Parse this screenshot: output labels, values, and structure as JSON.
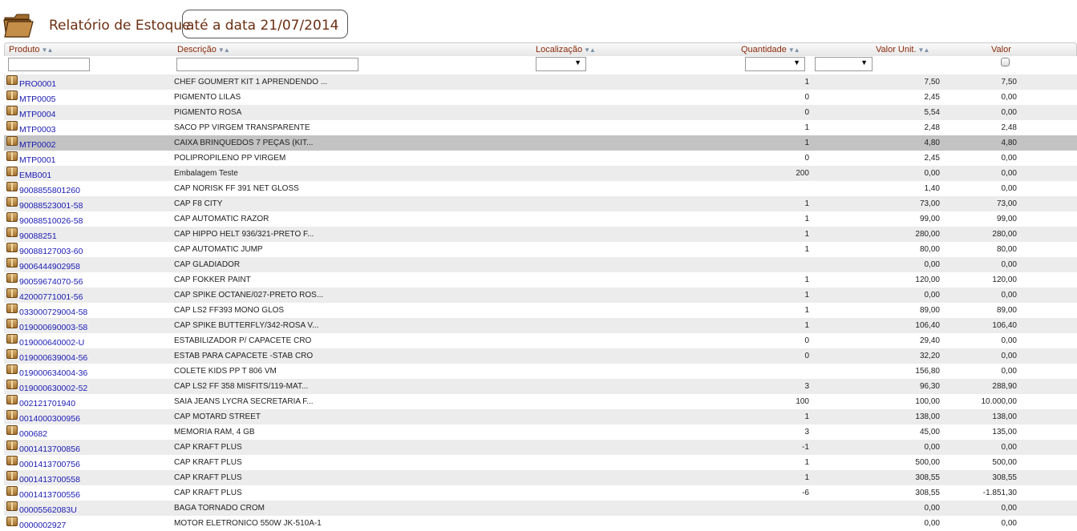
{
  "header": {
    "title": "Relatório de Estoque",
    "date_label": "até a data 21/07/2014"
  },
  "columns": {
    "produto": "Produto",
    "descricao": "Descrição",
    "localizacao": "Localização",
    "quantidade": "Quantidade",
    "valor_unit": "Valor Unit.",
    "valor": "Valor"
  },
  "icons": {
    "title": "folder-icon",
    "row": "package-icon",
    "sort": "sort-arrows-icon",
    "dropdown": "dropdown-arrow-icon"
  },
  "filters": {
    "produto_value": "",
    "descricao_value": "",
    "localizacao_selected": "",
    "quantidade_op_selected": "",
    "quantidade_selected": "",
    "valor_checked": false
  },
  "selected_row": 4,
  "rows": [
    {
      "code": "PRO0001",
      "desc": "CHEF GOUMERT KIT 1 APRENDENDO ...",
      "qty": "1",
      "unit": "7,50",
      "value": "7,50"
    },
    {
      "code": "MTP0005",
      "desc": "PIGMENTO LILAS",
      "qty": "0",
      "unit": "2,45",
      "value": "0,00"
    },
    {
      "code": "MTP0004",
      "desc": "PIGMENTO ROSA",
      "qty": "0",
      "unit": "5,54",
      "value": "0,00"
    },
    {
      "code": "MTP0003",
      "desc": "SACO PP VIRGEM TRANSPARENTE",
      "qty": "1",
      "unit": "2,48",
      "value": "2,48"
    },
    {
      "code": "MTP0002",
      "desc": "CAIXA BRINQUEDOS 7 PEÇAS (KIT...",
      "qty": "1",
      "unit": "4,80",
      "value": "4,80"
    },
    {
      "code": "MTP0001",
      "desc": "POLIPROPILENO PP VIRGEM",
      "qty": "0",
      "unit": "2,45",
      "value": "0,00"
    },
    {
      "code": "EMB001",
      "desc": "Embalagem Teste",
      "qty": "200",
      "unit": "0,00",
      "value": "0,00"
    },
    {
      "code": "9008855801260",
      "desc": "CAP NORISK FF 391 NET GLOSS",
      "qty": "",
      "unit": "1,40",
      "value": "0,00"
    },
    {
      "code": "90088523001-58",
      "desc": "CAP F8 CITY",
      "qty": "1",
      "unit": "73,00",
      "value": "73,00"
    },
    {
      "code": "90088510026-58",
      "desc": "CAP AUTOMATIC RAZOR",
      "qty": "1",
      "unit": "99,00",
      "value": "99,00"
    },
    {
      "code": "90088251",
      "desc": "CAP HIPPO HELT 936/321-PRETO F...",
      "qty": "1",
      "unit": "280,00",
      "value": "280,00"
    },
    {
      "code": "90088127003-60",
      "desc": "CAP AUTOMATIC JUMP",
      "qty": "1",
      "unit": "80,00",
      "value": "80,00"
    },
    {
      "code": "9006444902958",
      "desc": "CAP GLADIADOR",
      "qty": "",
      "unit": "0,00",
      "value": "0,00"
    },
    {
      "code": "90059674070-56",
      "desc": "CAP FOKKER PAINT",
      "qty": "1",
      "unit": "120,00",
      "value": "120,00"
    },
    {
      "code": "42000771001-56",
      "desc": "CAP SPIKE OCTANE/027-PRETO ROS...",
      "qty": "1",
      "unit": "0,00",
      "value": "0,00"
    },
    {
      "code": "033000729004-58",
      "desc": "CAP LS2 FF393 MONO GLOS",
      "qty": "1",
      "unit": "89,00",
      "value": "89,00"
    },
    {
      "code": "019000690003-58",
      "desc": "CAP SPIKE BUTTERFLY/342-ROSA V...",
      "qty": "1",
      "unit": "106,40",
      "value": "106,40"
    },
    {
      "code": "019000640002-U",
      "desc": "ESTABILIZADOR P/ CAPACETE CRO",
      "qty": "0",
      "unit": "29,40",
      "value": "0,00"
    },
    {
      "code": "019000639004-56",
      "desc": "ESTAB PARA CAPACETE -STAB CRO",
      "qty": "0",
      "unit": "32,20",
      "value": "0,00"
    },
    {
      "code": "019000634004-36",
      "desc": "COLETE KIDS PP T 806 VM",
      "qty": "",
      "unit": "156,80",
      "value": "0,00"
    },
    {
      "code": "019000630002-52",
      "desc": "CAP LS2 FF 358 MISFITS/119-MAT...",
      "qty": "3",
      "unit": "96,30",
      "value": "288,90"
    },
    {
      "code": "002121701940",
      "desc": "SAIA JEANS LYCRA SECRETARIA F...",
      "qty": "100",
      "unit": "100,00",
      "value": "10.000,00"
    },
    {
      "code": "0014000300956",
      "desc": "CAP MOTARD STREET",
      "qty": "1",
      "unit": "138,00",
      "value": "138,00"
    },
    {
      "code": "000682",
      "desc": "MEMORIA RAM, 4 GB",
      "qty": "3",
      "unit": "45,00",
      "value": "135,00"
    },
    {
      "code": "0001413700856",
      "desc": "CAP KRAFT PLUS",
      "qty": "-1",
      "unit": "0,00",
      "value": "0,00"
    },
    {
      "code": "0001413700756",
      "desc": "CAP KRAFT PLUS",
      "qty": "1",
      "unit": "500,00",
      "value": "500,00"
    },
    {
      "code": "0001413700558",
      "desc": "CAP KRAFT PLUS",
      "qty": "1",
      "unit": "308,55",
      "value": "308,55"
    },
    {
      "code": "0001413700556",
      "desc": "CAP KRAFT PLUS",
      "qty": "-6",
      "unit": "308,55",
      "value": "-1.851,30"
    },
    {
      "code": "00005562083U",
      "desc": "BAGA TORNADO CROM",
      "qty": "",
      "unit": "0,00",
      "value": "0,00"
    },
    {
      "code": "0000002927",
      "desc": "MOTOR ELETRONICO 550W JK-510A-1",
      "qty": "",
      "unit": "0,00",
      "value": "0,00"
    }
  ]
}
